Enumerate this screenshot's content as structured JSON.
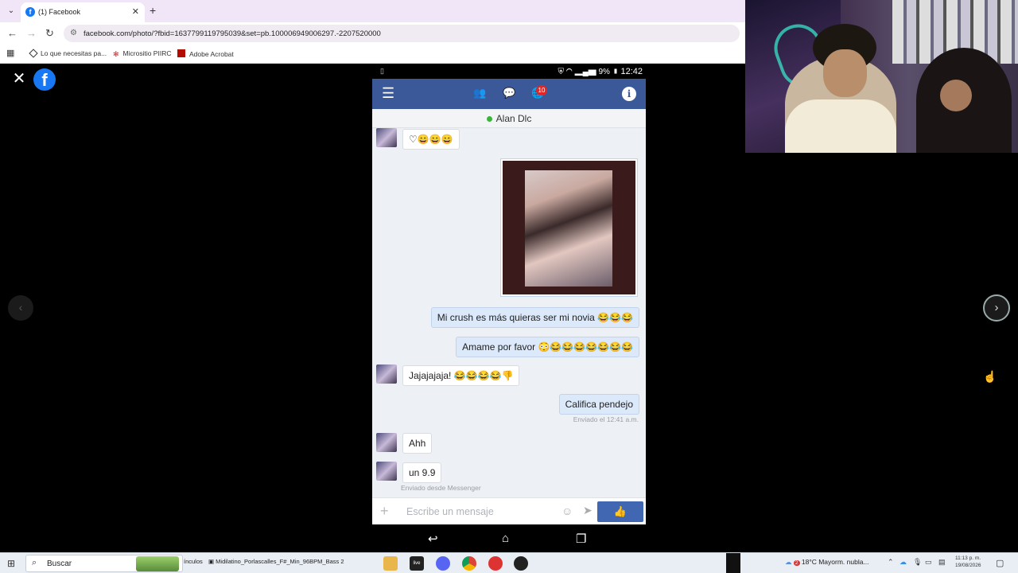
{
  "browser": {
    "tab_title": "(1) Facebook",
    "tab_close": "✕",
    "new_tab": "+",
    "url": "facebook.com/photo/?fbid=1637799119795039&set=pb.100006949006297.-2207520000",
    "bookmarks": [
      {
        "label": "Lo que necesitas pa..."
      },
      {
        "label": "Micrositio PIIRC"
      },
      {
        "label": "Adobe Acrobat"
      }
    ]
  },
  "viewer": {
    "close": "✕",
    "logo": "f",
    "prev": "‹",
    "next": "›"
  },
  "phone": {
    "status": {
      "battery": "9%",
      "time": "12:42"
    },
    "notif_badge": "10",
    "contact_name": "Alan Dlc",
    "messages": [
      {
        "dir": "in",
        "text": "♡😄😄😄"
      },
      {
        "dir": "out",
        "text": "Mi crush es más quieras ser mi novia 😂😂😂"
      },
      {
        "dir": "out",
        "text": "Amame por favor 😳😂😂😂😂😂😂😂"
      },
      {
        "dir": "in",
        "text": "Jajajajaja! 😂😂😂😂👎"
      },
      {
        "dir": "out",
        "text": "Califica pendejo"
      },
      {
        "dir": "in",
        "text": "Ahh"
      },
      {
        "dir": "in",
        "text": "un 9.9"
      }
    ],
    "sent_meta": "Enviado el 12:41 a.m.",
    "messenger_meta": "Enviado desde Messenger",
    "composer_placeholder": "Escribe un mensaje"
  },
  "taskbar": {
    "search_placeholder": "Buscar",
    "window_fragment": "ínculos",
    "window_title": "Midilatino_Porlascalles_F#_Min_96BPM_Bass 2",
    "weather": "18°C  Mayorm. nubla...",
    "weather_badge": "2",
    "clock_time": "11:13 p. m.",
    "clock_date": "19/08/2026"
  }
}
